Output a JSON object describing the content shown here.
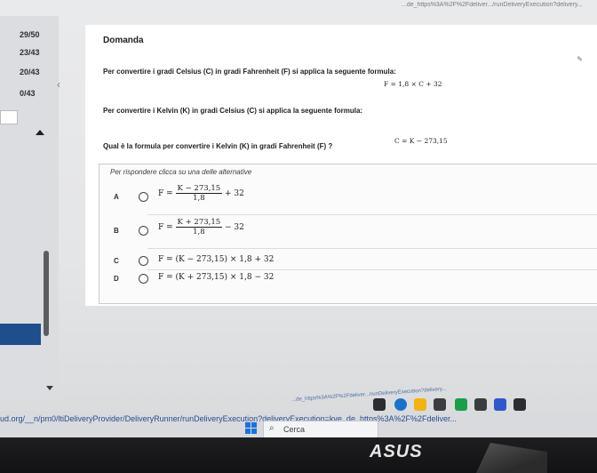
{
  "browser": {
    "url_top": "...de_https%3A%2F%2Fdeliver.../runDeliveryExecution?delivery..."
  },
  "sidebar": {
    "scores": [
      "29/50",
      "23/43",
      "20/43",
      "0/43"
    ]
  },
  "question": {
    "label": "Domanda",
    "stmt_celsius_fahrenheit": "Per convertire i gradi Celsius (C) in gradi Fahrenheit (F) si applica la seguente formula:",
    "formula_cf": "F = 1,8 × C + 32",
    "stmt_kelvin_celsius": "Per convertire i Kelvin (K) in gradi Celsius (C) si applica la seguente formula:",
    "formula_kc": "C = K − 273,15",
    "ask": "Qual è la formula per convertire i Kelvin (K) in gradi Fahrenheit (F) ?"
  },
  "answers": {
    "prompt": "Per rispondere clicca su una delle alternative",
    "options": [
      {
        "letter": "A",
        "prefix": "F =",
        "num": "K − 273,15",
        "den": "1,8",
        "suffix": "+ 32"
      },
      {
        "letter": "B",
        "prefix": "F =",
        "num": "K + 273,15",
        "den": "1,8",
        "suffix": "− 32"
      },
      {
        "letter": "C",
        "text": "F = (K − 273,15) × 1,8 + 32"
      },
      {
        "letter": "D",
        "text": "F = (K + 273,15) × 1,8 − 32"
      }
    ]
  },
  "taskbar": {
    "url": "ud.org/__n/pm0/ltiDeliveryProvider/DeliveryRunner/runDeliveryExecution?deliveryExecution=kve_de_https%3A%2F%2Fdeliver...",
    "search_placeholder": "Cerca"
  },
  "monitor": {
    "brand": "ASUS"
  },
  "colors": {
    "accent_blue": "#1f4e8c",
    "windows_blue": "#1a73d9"
  }
}
